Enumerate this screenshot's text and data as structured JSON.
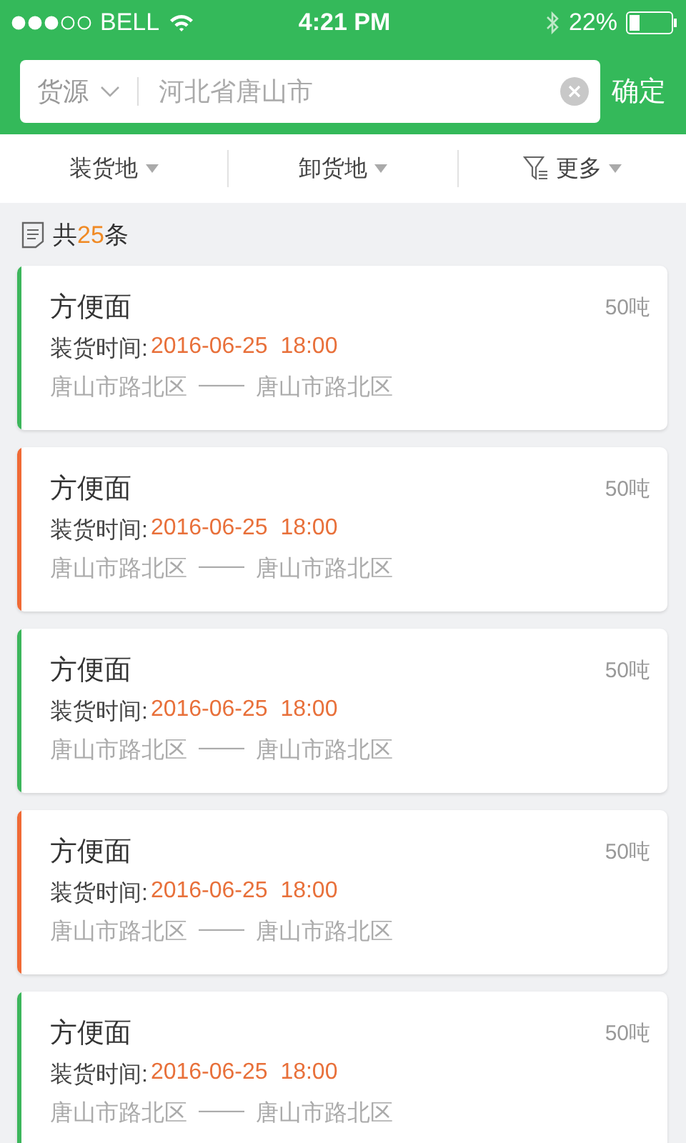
{
  "status_bar": {
    "carrier": "BELL",
    "time": "4:21 PM",
    "battery": "22%"
  },
  "search": {
    "category": "货源",
    "placeholder": "河北省唐山市",
    "confirm": "确定"
  },
  "filters": [
    {
      "label": "装货地",
      "kind": "plain"
    },
    {
      "label": "卸货地",
      "kind": "plain"
    },
    {
      "label": "更多",
      "kind": "filter"
    }
  ],
  "count": {
    "prefix": "共",
    "number": "25",
    "suffix": "条"
  },
  "cards": [
    {
      "name": "方便面",
      "weight": "50吨",
      "time_label": "装货时间:",
      "time": "2016-06-25  18:00",
      "from": "唐山市路北区",
      "dash": "——",
      "to": "唐山市路北区",
      "color": "#3cb65b"
    },
    {
      "name": "方便面",
      "weight": "50吨",
      "time_label": "装货时间:",
      "time": "2016-06-25  18:00",
      "from": "唐山市路北区",
      "dash": "——",
      "to": "唐山市路北区",
      "color": "#f06a35"
    },
    {
      "name": "方便面",
      "weight": "50吨",
      "time_label": "装货时间:",
      "time": "2016-06-25  18:00",
      "from": "唐山市路北区",
      "dash": "——",
      "to": "唐山市路北区",
      "color": "#3cb65b"
    },
    {
      "name": "方便面",
      "weight": "50吨",
      "time_label": "装货时间:",
      "time": "2016-06-25  18:00",
      "from": "唐山市路北区",
      "dash": "——",
      "to": "唐山市路北区",
      "color": "#f06a35"
    },
    {
      "name": "方便面",
      "weight": "50吨",
      "time_label": "装货时间:",
      "time": "2016-06-25  18:00",
      "from": "唐山市路北区",
      "dash": "——",
      "to": "唐山市路北区",
      "color": "#3cb65b"
    }
  ]
}
